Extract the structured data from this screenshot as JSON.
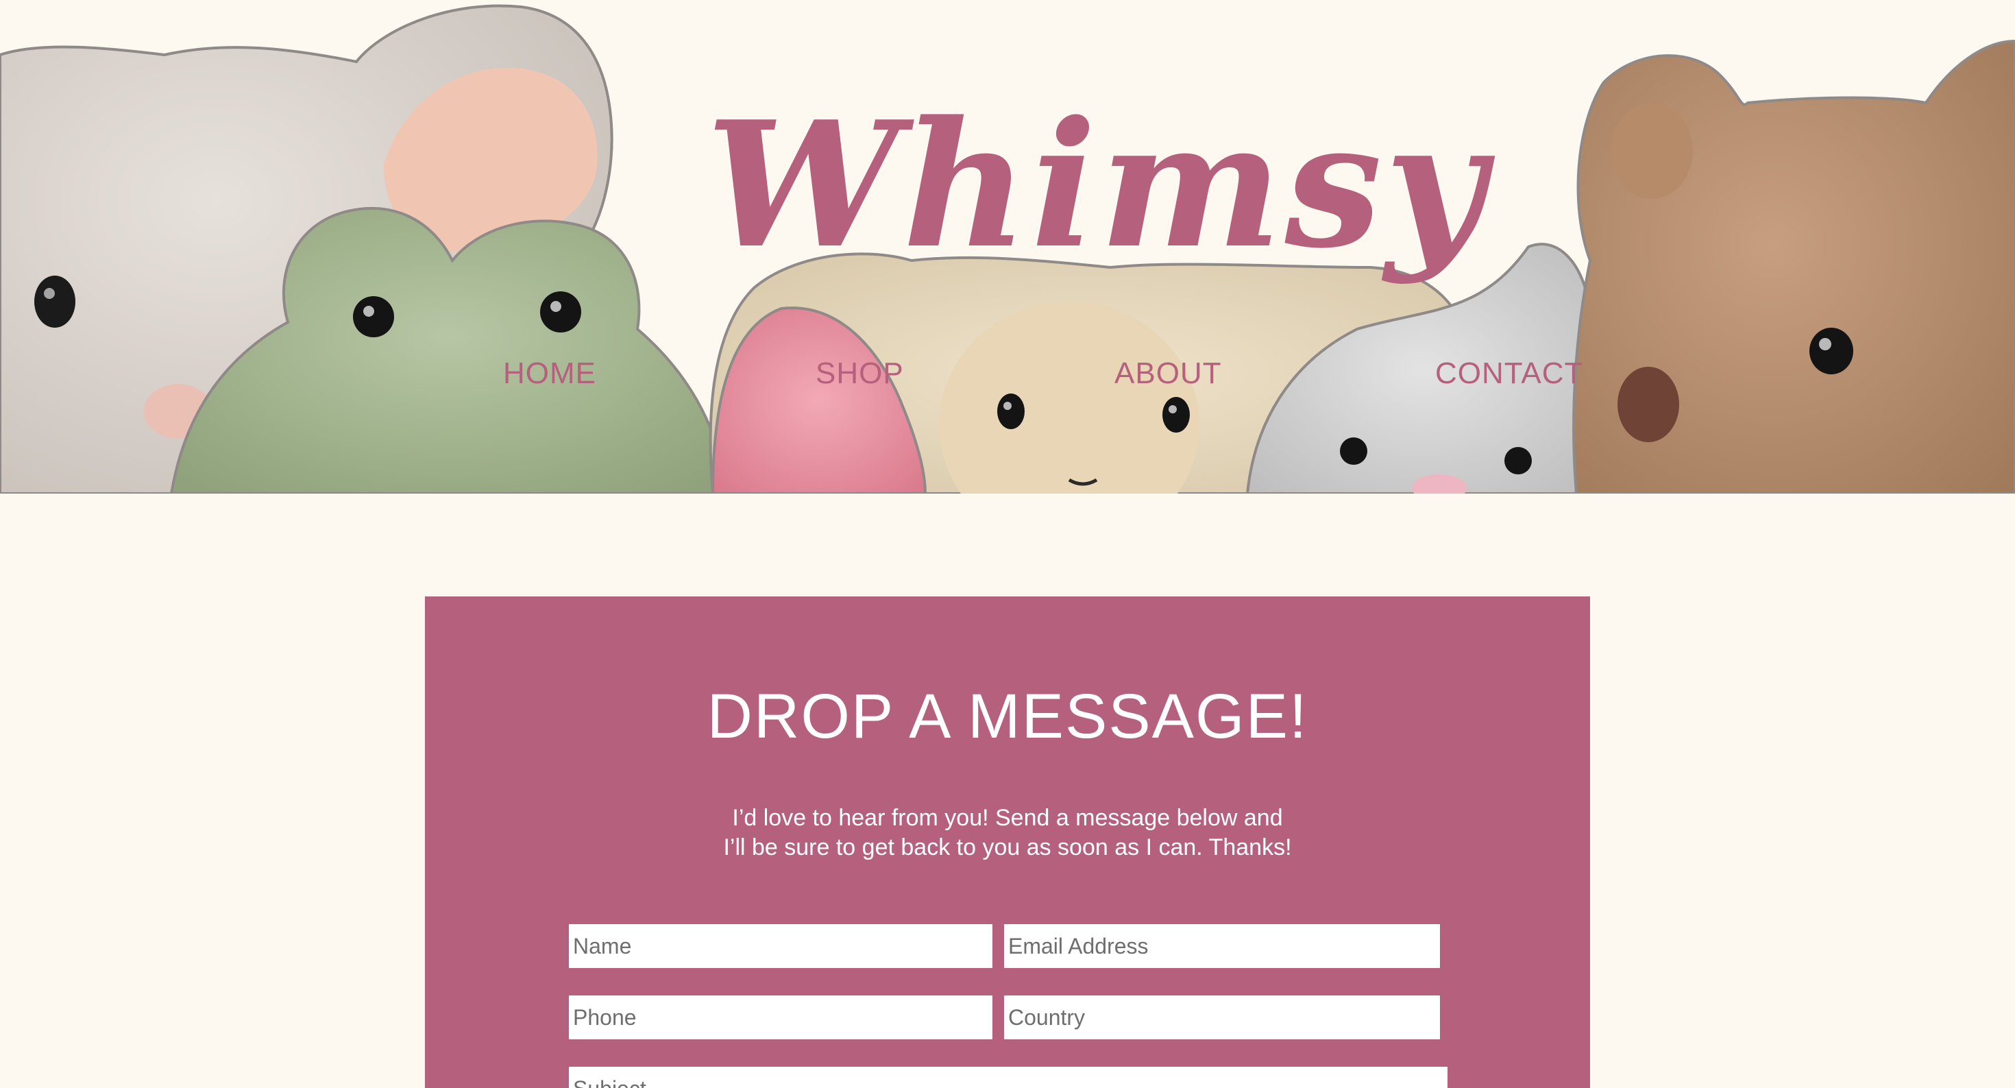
{
  "header": {
    "brand": "Whimsy",
    "nav": [
      {
        "label": "HOME"
      },
      {
        "label": "SHOP"
      },
      {
        "label": "ABOUT"
      },
      {
        "label": "CONTACT"
      }
    ]
  },
  "hero": {
    "icons": [
      "mouse-plush-icon",
      "frog-plush-icon",
      "pink-bunny-ear-icon",
      "lamb-plush-icon",
      "grey-bunny-plush-icon",
      "teddy-bear-plush-icon"
    ]
  },
  "contact": {
    "title": "DROP A MESSAGE!",
    "intro_line1": "I’d love to hear from you! Send a message below and",
    "intro_line2": "I’ll be sure to get back to you as soon as I can. Thanks!",
    "fields": {
      "name_placeholder": "Name",
      "email_placeholder": "Email Address",
      "phone_placeholder": "Phone",
      "country_placeholder": "Country",
      "subject_placeholder": "Subject"
    }
  },
  "colors": {
    "accent": "#b5607d",
    "background": "#fdf9f1",
    "field": "#ffffff"
  }
}
